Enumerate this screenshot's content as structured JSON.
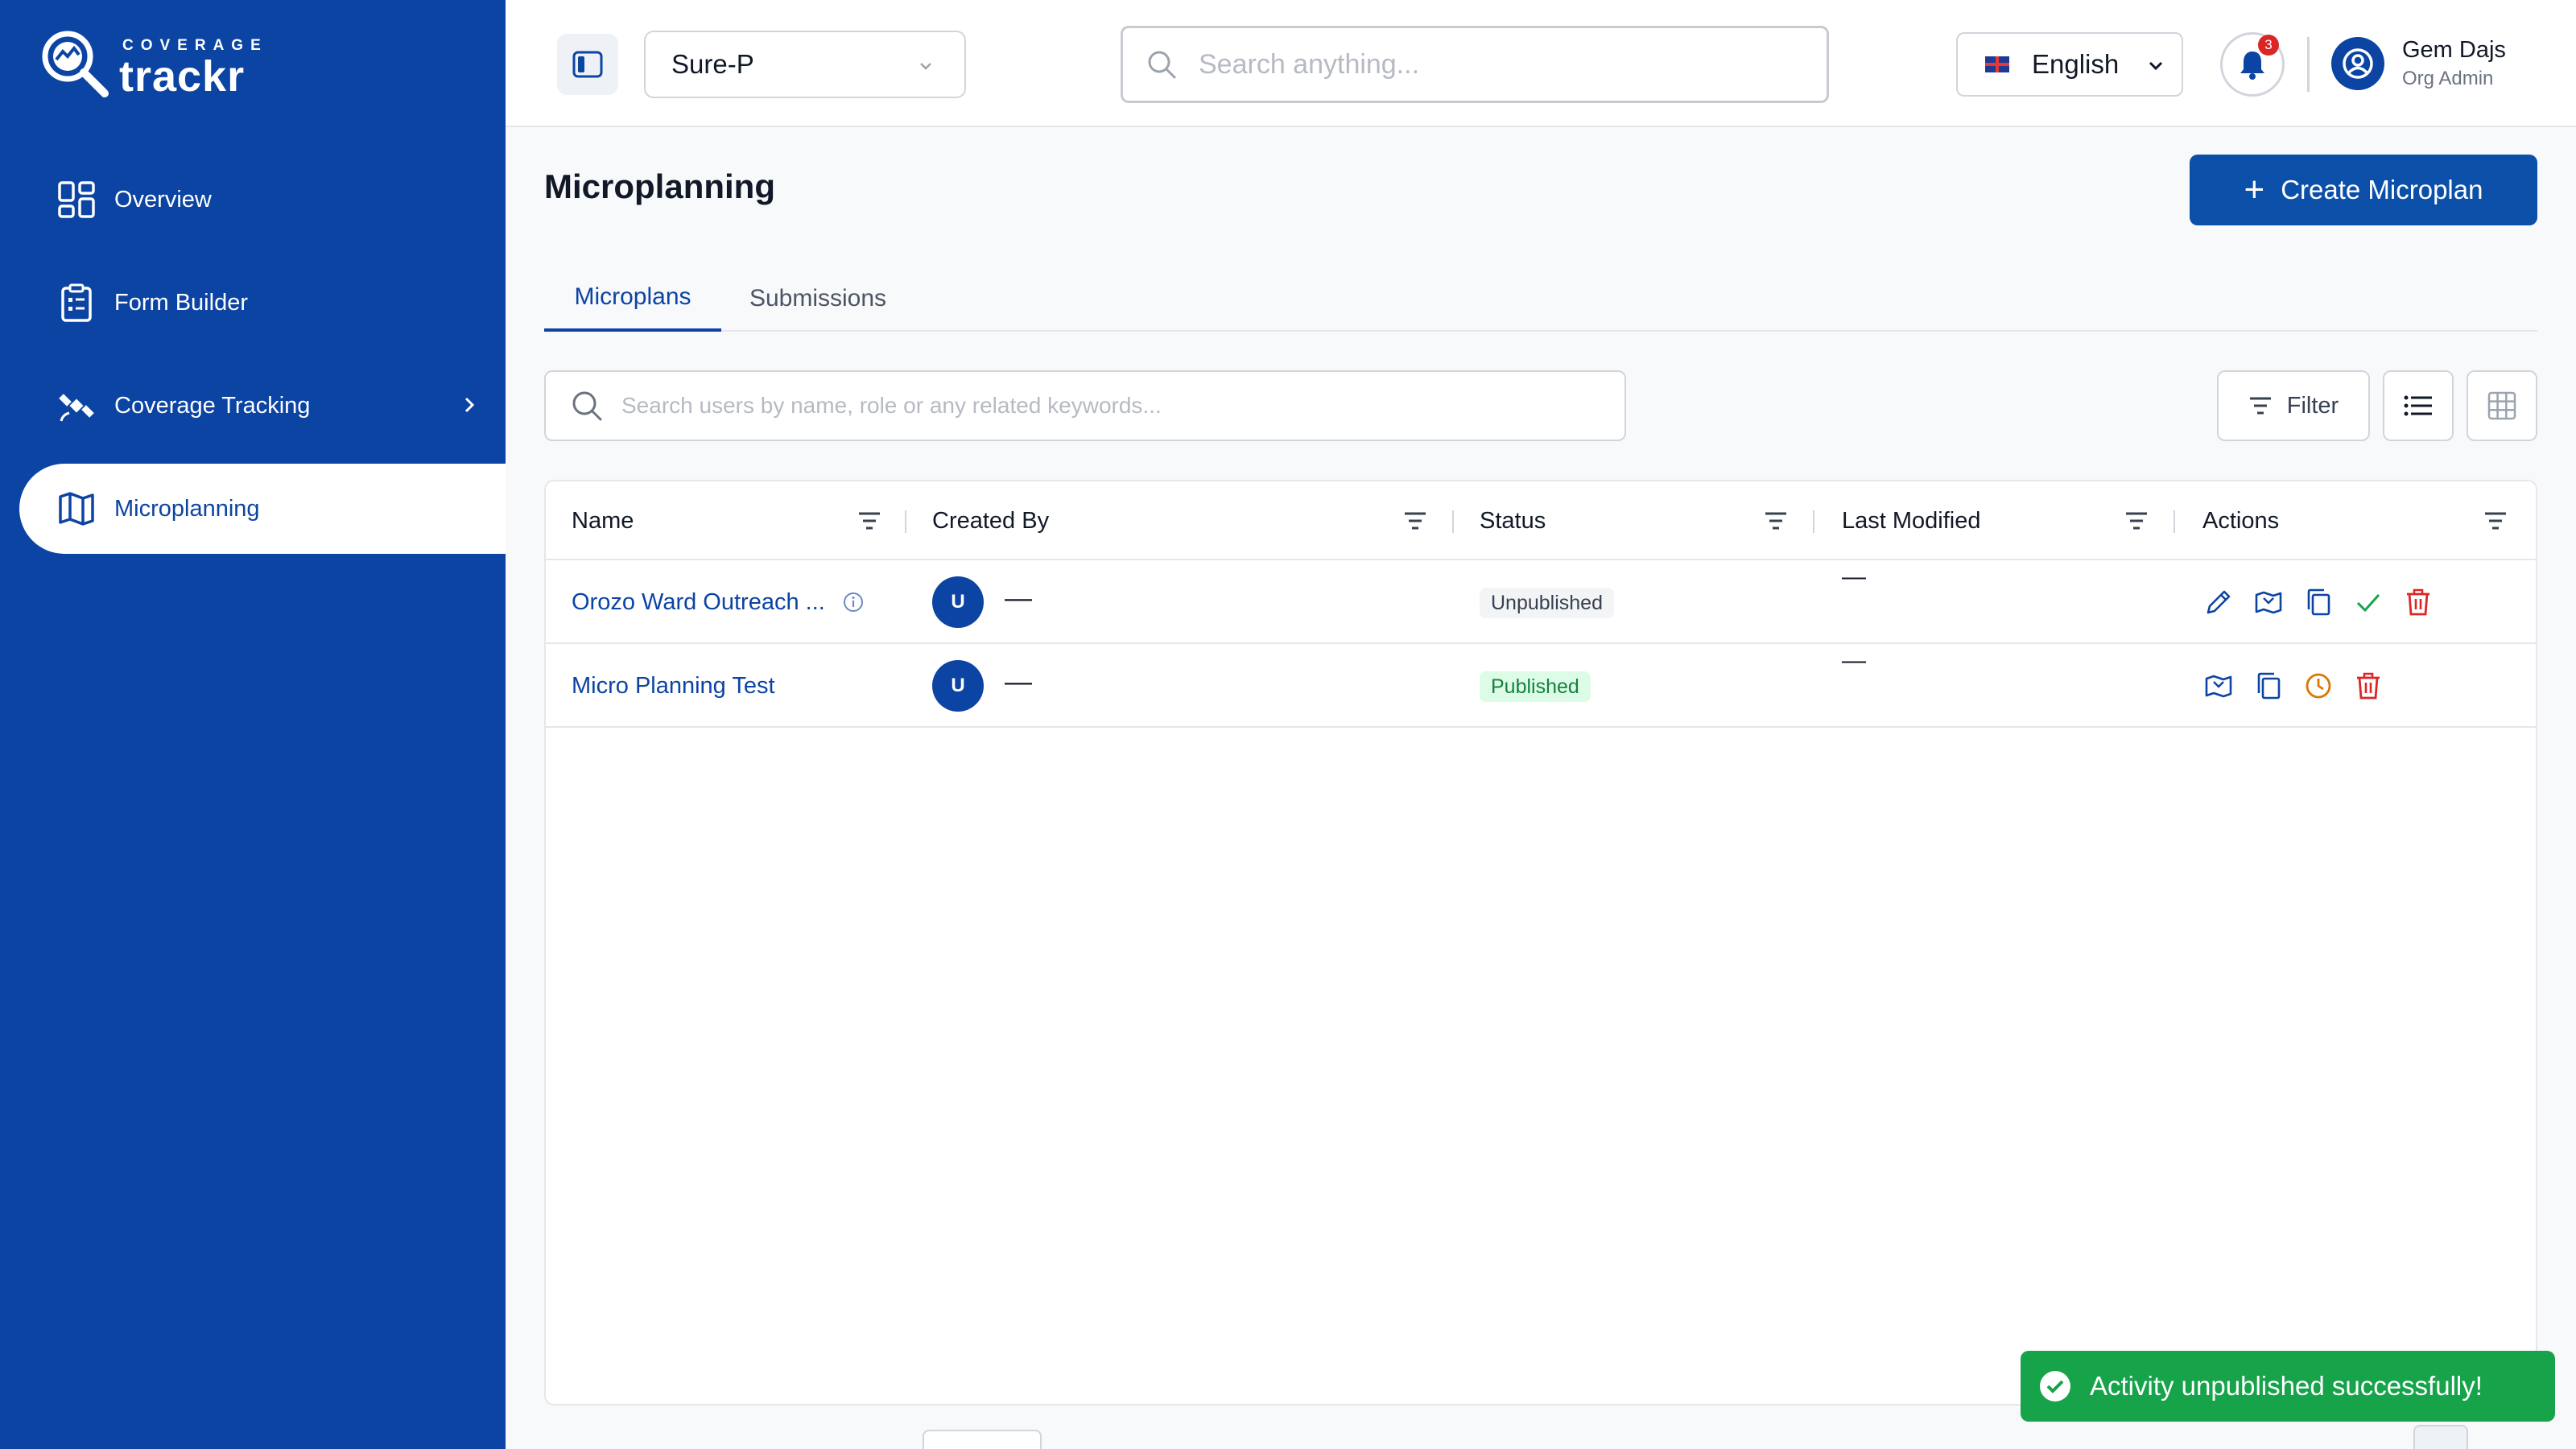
{
  "brand": {
    "small": "COVERAGE",
    "big": "trackr"
  },
  "sidebar": {
    "items": [
      {
        "label": "Overview",
        "icon": "dashboard-icon"
      },
      {
        "label": "Form Builder",
        "icon": "clipboard-icon"
      },
      {
        "label": "Coverage Tracking",
        "icon": "satellite-icon"
      },
      {
        "label": "Microplanning",
        "icon": "map-icon"
      }
    ]
  },
  "topbar": {
    "org": "Sure-P",
    "search_placeholder": "Search anything...",
    "language": "English",
    "notifications": "3",
    "user_name": "Gem Dajs",
    "user_role": "Org Admin"
  },
  "main": {
    "title": "Microplanning",
    "create_label": "Create Microplan",
    "tabs": [
      {
        "label": "Microplans"
      },
      {
        "label": "Submissions"
      }
    ],
    "table_search_placeholder": "Search users by name, role or any related keywords...",
    "filter_label": "Filter"
  },
  "table": {
    "columns": [
      "Name",
      "Created By",
      "Status",
      "Last Modified",
      "Actions"
    ],
    "rows": [
      {
        "name": "Orozo Ward Outreach ...",
        "avatar": "U",
        "created_by": "—",
        "status": "Unpublished",
        "last_modified": "—"
      },
      {
        "name": "Micro Planning Test",
        "avatar": "U",
        "created_by": "—",
        "status": "Published",
        "last_modified": "—"
      }
    ]
  },
  "toast": {
    "message": "Activity unpublished successfully!"
  },
  "colors": {
    "primary": "#0c44a3",
    "success": "#16a34a",
    "danger": "#dc2626",
    "warning": "#d97706"
  }
}
